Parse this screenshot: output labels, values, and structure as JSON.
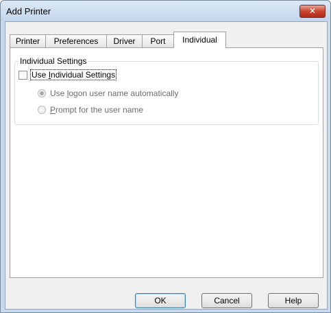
{
  "window": {
    "title": "Add Printer"
  },
  "tabs": [
    {
      "label": "Printer"
    },
    {
      "label": "Preferences"
    },
    {
      "label": "Driver"
    },
    {
      "label": "Port"
    },
    {
      "label": "Individual",
      "active": true
    }
  ],
  "group": {
    "title": "Individual Settings",
    "checkbox": {
      "label_pre": "Use ",
      "label_accel": "I",
      "label_post": "ndividual Settings",
      "checked": false
    },
    "radios": [
      {
        "label_pre": "Use ",
        "label_accel": "l",
        "label_post": "ogon user name automatically",
        "selected": true,
        "enabled": false
      },
      {
        "label_pre": "",
        "label_accel": "P",
        "label_post": "rompt for the user name",
        "selected": false,
        "enabled": false
      }
    ]
  },
  "buttons": {
    "ok": "OK",
    "cancel": "Cancel",
    "help": "Help"
  },
  "icons": {
    "close": "close-icon"
  }
}
